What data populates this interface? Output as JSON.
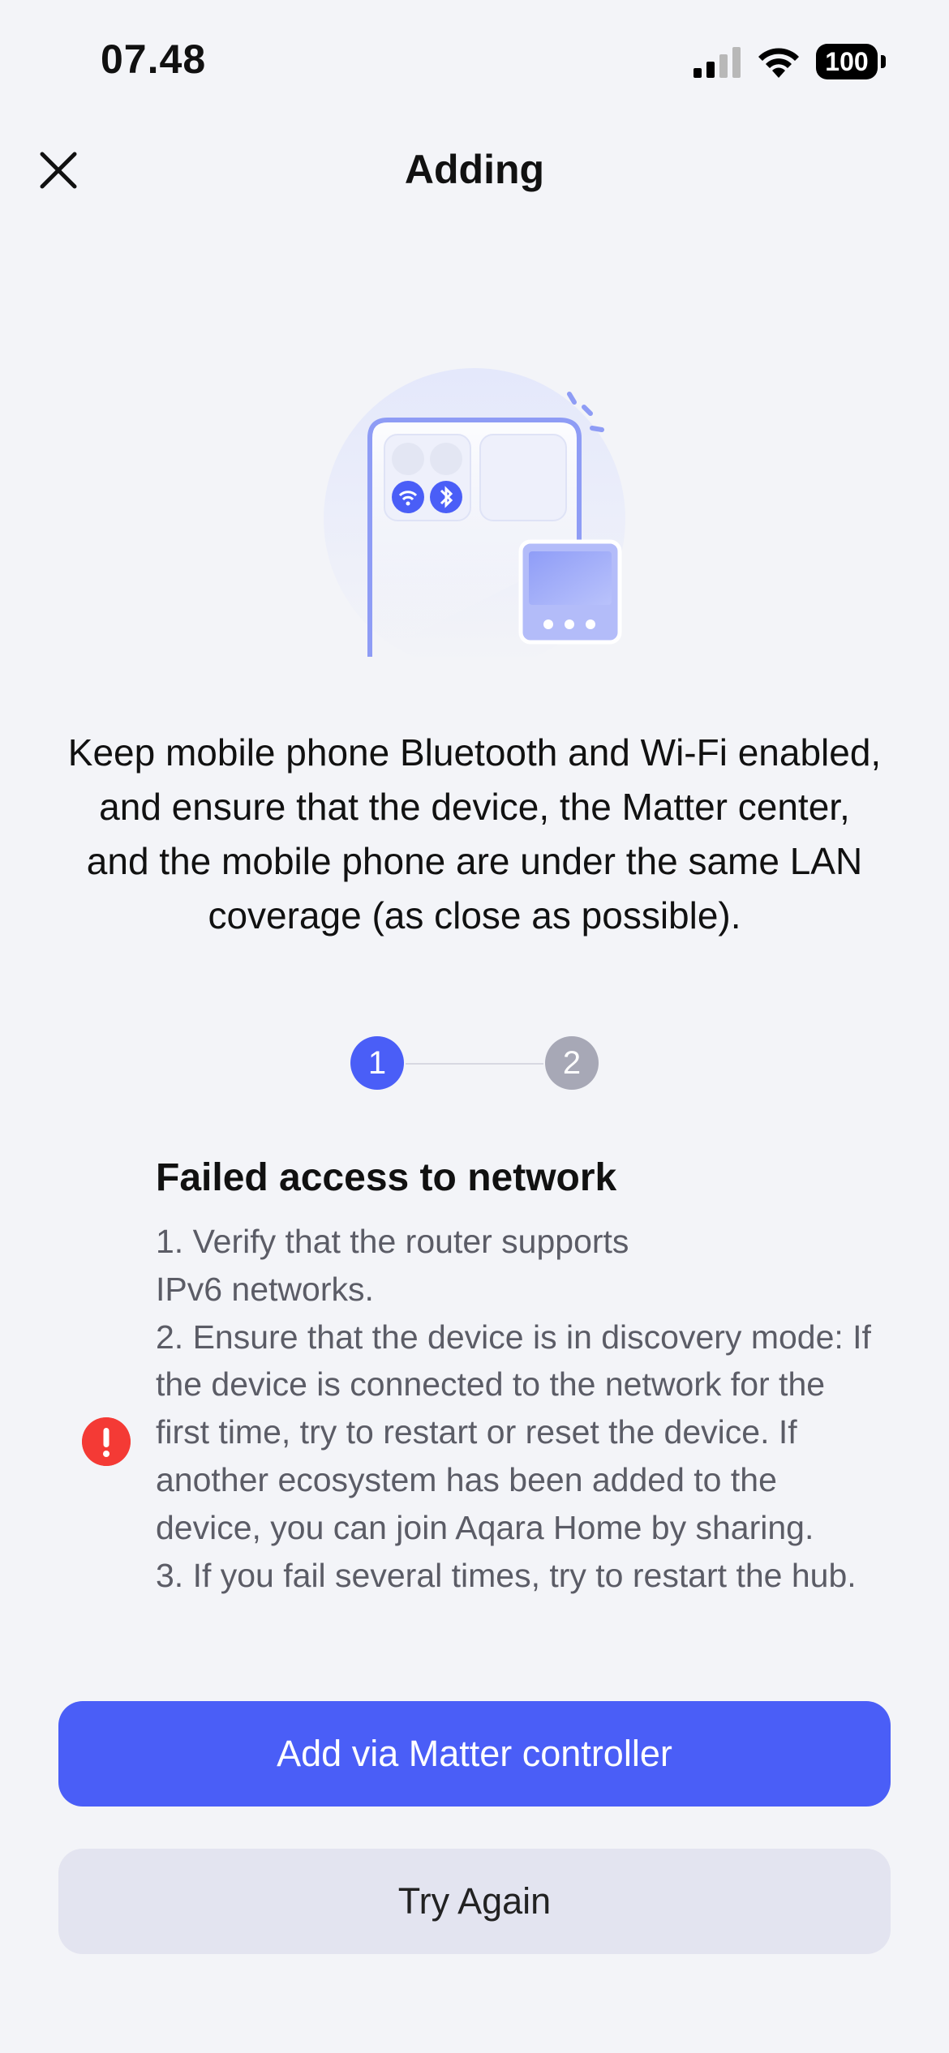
{
  "status_bar": {
    "time": "07.48",
    "battery": "100",
    "icons": [
      "cellular-signal-icon",
      "wifi-icon",
      "battery-icon"
    ]
  },
  "nav": {
    "title": "Adding",
    "close_icon": "close-icon"
  },
  "instruction": "Keep mobile phone Bluetooth and Wi-Fi enabled, and ensure that the device, the Matter center, and the mobile phone are under the same LAN coverage (as close as possible).",
  "stepper": {
    "steps": [
      "1",
      "2"
    ],
    "current": 1
  },
  "error": {
    "icon": "alert-icon",
    "title": "Failed access to network",
    "body": "1. Verify that the router supports\nIPv6 networks.\n2. Ensure that the device is in discovery mode: If the device is connected to the network for the first time, try to restart or reset the device. If another ecosystem has been added to the device, you can join Aqara Home by sharing.\n3. If you fail several times, try to restart the hub."
  },
  "buttons": {
    "primary": "Add via Matter controller",
    "secondary": "Try Again"
  },
  "colors": {
    "accent": "#4a5ef7",
    "error": "#f43a35",
    "background": "#f3f4f8",
    "secondary_button": "#e3e4f0"
  }
}
